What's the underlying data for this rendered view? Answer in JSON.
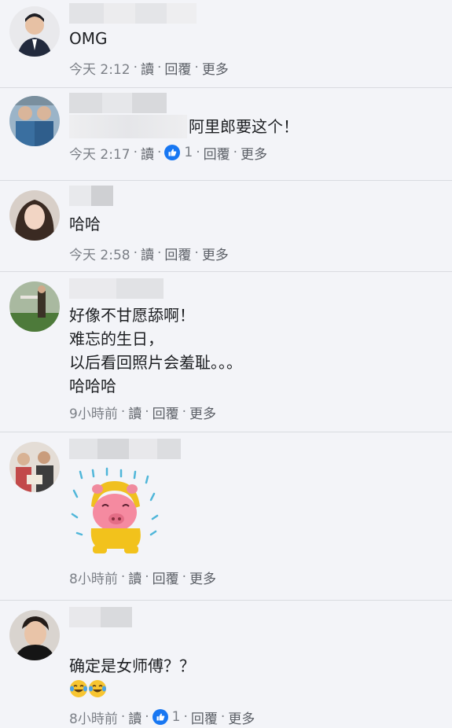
{
  "comments": [
    {
      "text": "OMG",
      "time": "今天 2:12",
      "actions": {
        "read": "讀",
        "reply": "回覆",
        "more": "更多"
      }
    },
    {
      "text": "阿里郎要这个！",
      "time": "今天 2:17",
      "likes": "1",
      "actions": {
        "read": "讀",
        "reply": "回覆",
        "more": "更多"
      }
    },
    {
      "text": "哈哈",
      "time": "今天 2:58",
      "actions": {
        "read": "讀",
        "reply": "回覆",
        "more": "更多"
      }
    },
    {
      "text": "好像不甘愿舔啊！\n难忘的生日，\n以后看回照片会羞耻。。。\n哈哈哈",
      "time": "9小時前",
      "actions": {
        "read": "讀",
        "reply": "回覆",
        "more": "更多"
      }
    },
    {
      "sticker": "crying-pig-raincoat-sticker",
      "time": "8小時前",
      "actions": {
        "read": "讀",
        "reply": "回覆",
        "more": "更多"
      }
    },
    {
      "text": "确定是女师傅？？",
      "time": "8小時前",
      "likes": "1",
      "actions": {
        "read": "讀",
        "reply": "回覆",
        "more": "更多"
      }
    }
  ],
  "colors": {
    "like_blue": "#1877f2",
    "meta_gray": "#7b7f86",
    "background": "#f3f4f8"
  }
}
